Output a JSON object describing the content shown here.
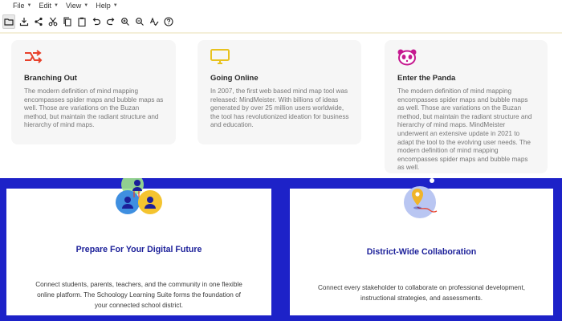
{
  "menubar": {
    "items": [
      {
        "label": "File"
      },
      {
        "label": "Edit"
      },
      {
        "label": "View"
      },
      {
        "label": "Help"
      }
    ]
  },
  "toolbar": {
    "tools": [
      "open-icon",
      "download-icon",
      "share-icon",
      "cut-icon",
      "copy-icon",
      "paste-icon",
      "undo-icon",
      "redo-icon",
      "zoom-in-icon",
      "zoom-out-icon",
      "spellcheck-icon",
      "help-icon"
    ]
  },
  "cards": [
    {
      "title": "Branching Out",
      "icon": "branch-arrows-icon",
      "text": "The modern definition of mind mapping encompasses spider maps and bubble maps as well. Those are variations on the Buzan method, but maintain the radiant structure and hierarchy of mind maps."
    },
    {
      "title": "Going Online",
      "icon": "monitor-icon",
      "text": "In 2007, the first web based mind map tool was released: MindMeister. With billions of ideas generated by over 25 million users worldwide, the tool has revolutionized ideation for business and education."
    },
    {
      "title": "Enter the Panda",
      "icon": "panda-icon",
      "text": "The modern definition of mind mapping encompasses spider maps and bubble maps as well. Those are variations on the Buzan method, but maintain the radiant structure and hierarchy of mind maps. MindMeister underwent an extensive update in 2021 to adapt the tool to the evolving user needs. The modern definition of mind mapping encompasses spider maps and bubble maps as well."
    }
  ],
  "promos": [
    {
      "title": "Prepare For Your Digital Future",
      "text": "Connect students, parents, teachers, and the community in one flexible online platform. The Schoology Learning Suite forms the foundation of your connected school district."
    },
    {
      "title": "District-Wide Collaboration",
      "text": "Connect every stakeholder to collaborate on professional development, instructional strategies, and assessments."
    }
  ],
  "colors": {
    "banner": "#1d22c8",
    "promo_title": "#1b1f99",
    "branch_icon": "#e8402a",
    "monitor_icon": "#e8c21e",
    "panda_icon": "#c5188f"
  }
}
